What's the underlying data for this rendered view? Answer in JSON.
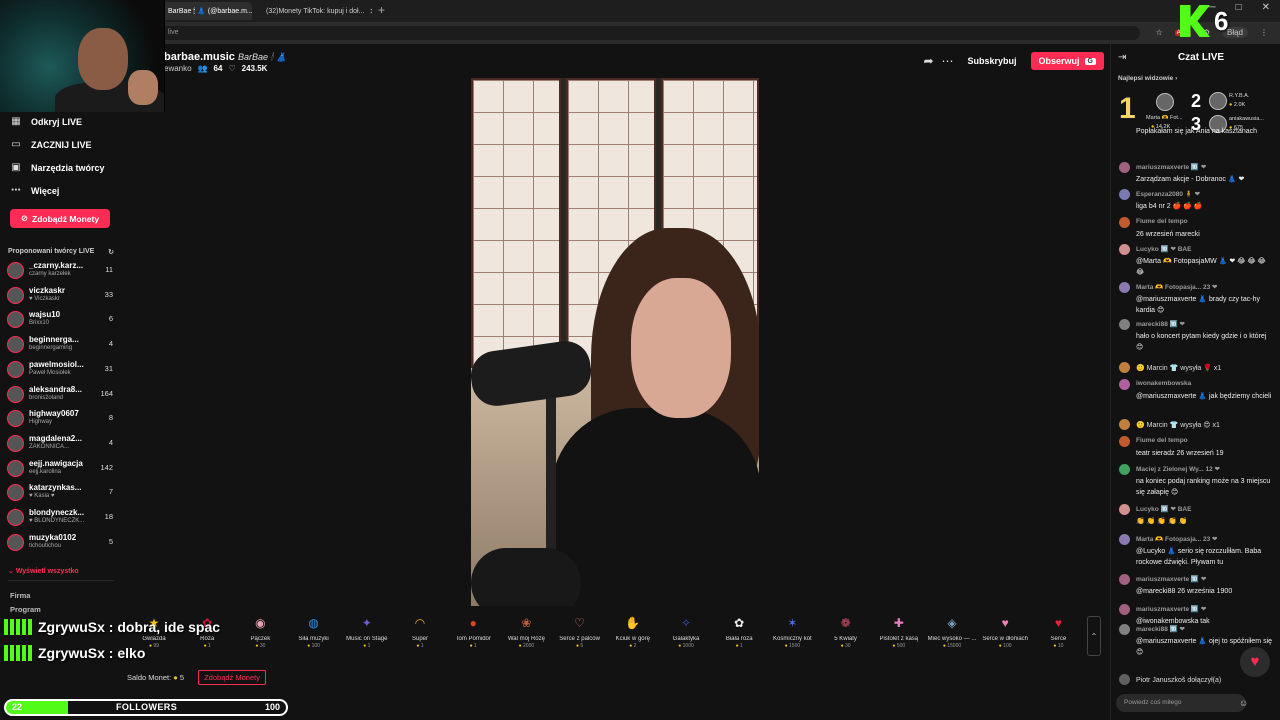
{
  "browser": {
    "tabs": [
      {
        "label": "BarBae 🕯 👗 (@barbae.m...",
        "active": true
      },
      {
        "label": "(32)Monety TikTok: kupuj i doł...",
        "active": false
      }
    ],
    "url": "live",
    "error_badge": "Błąd"
  },
  "stream": {
    "name": "barbae.music",
    "display_name": "BarBae 🕯 👗",
    "subtitle": "ewanko",
    "viewers": "64",
    "likes": "243.5K",
    "subscribe_label": "Subskrybuj",
    "follow_label": "Obserwuj",
    "follow_key": "G"
  },
  "sidebar": {
    "nav": [
      {
        "icon": "calendar-icon",
        "label": "Odkryj LIVE"
      },
      {
        "icon": "camera-icon",
        "label": "ZACZNIJ LIVE"
      },
      {
        "icon": "monitor-icon",
        "label": "Narzędzia twórcy"
      },
      {
        "icon": "more-icon",
        "label": "Więcej"
      }
    ],
    "coins_button": "Zdobądź Monety",
    "section_title": "Proponowani twórcy LIVE",
    "creators": [
      {
        "name": "_czarny.karz...",
        "sub": "czarny karzełek",
        "count": "11"
      },
      {
        "name": "viczkaskr",
        "sub": "♥ Viczkaskr",
        "count": "33"
      },
      {
        "name": "wajsu10",
        "sub": "Brixx10",
        "count": "6"
      },
      {
        "name": "beginnerga...",
        "sub": "beginnergaming",
        "count": "4"
      },
      {
        "name": "pawelmosiol...",
        "sub": "Paweł Mosiołek",
        "count": "31"
      },
      {
        "name": "aleksandra8...",
        "sub": "bronisżoland",
        "count": "164"
      },
      {
        "name": "highway0607",
        "sub": "Highway",
        "count": "8"
      },
      {
        "name": "magdalena2...",
        "sub": "ZAKONNICA...",
        "count": "4"
      },
      {
        "name": "eejj.nawigacja",
        "sub": "eejj.karolina",
        "count": "142"
      },
      {
        "name": "katarzynkas...",
        "sub": "♥ Kasia ♥",
        "count": "7"
      },
      {
        "name": "blondyneczk...",
        "sub": "♥ BLONDYNECZK...",
        "count": "18"
      },
      {
        "name": "muzyka0102",
        "sub": "tichoutichou",
        "count": "5"
      }
    ],
    "show_all": "Wyświetl wszystko",
    "footer": [
      "Firma",
      "Program"
    ]
  },
  "gifts": [
    {
      "name": "Gwiazda",
      "price": "99",
      "icon": "star-gift-icon",
      "color": "#f5c518",
      "glyph": "★"
    },
    {
      "name": "Róża",
      "price": "1",
      "icon": "rose-gift-icon",
      "color": "#c91a3a",
      "glyph": "✿"
    },
    {
      "name": "Pączek",
      "price": "30",
      "icon": "donut-gift-icon",
      "color": "#e8a0b0",
      "glyph": "◉"
    },
    {
      "name": "Siła muzyki",
      "price": "100",
      "icon": "globe-gift-icon",
      "color": "#3a8fd6",
      "glyph": "◍"
    },
    {
      "name": "Music on Stage",
      "price": "1",
      "icon": "stage-gift-icon",
      "color": "#6b5bd6",
      "glyph": "✦"
    },
    {
      "name": "Super",
      "price": "1",
      "icon": "glasses-gift-icon",
      "color": "#f5a623",
      "glyph": "◠"
    },
    {
      "name": "Tom Pomidor",
      "price": "1",
      "icon": "tomato-gift-icon",
      "color": "#d64520",
      "glyph": "●"
    },
    {
      "name": "Wal mój Różę",
      "price": "2000",
      "icon": "rose-bag-gift-icon",
      "color": "#c0603a",
      "glyph": "❀"
    },
    {
      "name": "Serce z palców",
      "price": "5",
      "icon": "finger-heart-gift-icon",
      "color": "#f0806a",
      "glyph": "♡"
    },
    {
      "name": "Kciuk w górę",
      "price": "2",
      "icon": "thumb-gift-icon",
      "color": "#f5b041",
      "glyph": "✋"
    },
    {
      "name": "Galaktyka",
      "price": "1000",
      "icon": "galaxy-gift-icon",
      "color": "#3d5ad6",
      "glyph": "✧"
    },
    {
      "name": "Biała róża",
      "price": "1",
      "icon": "white-rose-gift-icon",
      "color": "#eeeeee",
      "glyph": "✿"
    },
    {
      "name": "Kosmiczny kot",
      "price": "1500",
      "icon": "cat-gift-icon",
      "color": "#4a6ee0",
      "glyph": "✶"
    },
    {
      "name": "5 Kwiaty",
      "price": "30",
      "icon": "flowers-gift-icon",
      "color": "#d64a6a",
      "glyph": "❁"
    },
    {
      "name": "Pistolet z kasą",
      "price": "500",
      "icon": "money-gun-gift-icon",
      "color": "#e080c0",
      "glyph": "✚"
    },
    {
      "name": "Mieć wysoko — ...",
      "price": "15000",
      "icon": "jet-gift-icon",
      "color": "#7aa0c0",
      "glyph": "◈"
    },
    {
      "name": "Serce w dłoniach",
      "price": "100",
      "icon": "hands-heart-gift-icon",
      "color": "#f080b0",
      "glyph": "♥"
    },
    {
      "name": "Serce",
      "price": "10",
      "icon": "heart-gift-icon",
      "color": "#e6233a",
      "glyph": "♥"
    }
  ],
  "wallet": {
    "label": "Saldo Monet:",
    "amount": "5",
    "button": "Zdobądź Monety"
  },
  "overlay": {
    "chat_lines": [
      {
        "user": "ZgrywuSx",
        "text": "dobra, ide spac"
      },
      {
        "user": "ZgrywuSx",
        "text": "elko"
      }
    ],
    "kick_count": "6",
    "followers": {
      "current": 22,
      "goal": 100,
      "label": "FOLLOWERS"
    }
  },
  "chat": {
    "title": "Czat LIVE",
    "top_viewers_label": "Najlepsi widzowie",
    "top": [
      {
        "rank": "1",
        "name": "Marta 🫶 Fot...",
        "score": "14.2K"
      },
      {
        "rank": "2",
        "name": "R.Y.B.A.",
        "score": "2.0K"
      },
      {
        "rank": "3",
        "name": "aniakawusia...",
        "score": "675"
      }
    ],
    "messages": [
      {
        "user": "",
        "text": "Popłakałam się jak Ania na kasztanach",
        "color": "#8a5a3a"
      },
      {
        "user": "mariuszmaxverte 🔟 ❤",
        "text": "Zarządzam akcje - Dobranoc 👗 ❤",
        "color": "#a06080"
      },
      {
        "user": "Esperanza2080 🧍 ❤",
        "text": "liga b4 nr 2 🍎 🍎 🍎",
        "color": "#7a7ab0"
      },
      {
        "user": "Fiume del tempo",
        "text": "26 wrzesień marecki",
        "color": "#c05a30"
      },
      {
        "user": "Lucyko 🔟 ❤ BAE",
        "text": "@Marta 🫶 FotopasjaMW 👗 ❤ 😂 😂 😂 😂",
        "color": "#d09090"
      },
      {
        "user": "Marta 🫶 Fotopasja... 23 ❤",
        "text": "@mariuszmaxverte 👗 brady czy tac-hy kardia 😊",
        "color": "#8a7ab0"
      },
      {
        "user": "marecki88 🔟 ❤",
        "text": "hało o koncert pytam kiedy gdzie i o której 😊",
        "color": "#808080"
      },
      {
        "user": "",
        "text": "🙂 Marcin 👕 wysyła 🌹 x1",
        "color": "#c08040",
        "system": true
      },
      {
        "user": "iwonakembowska",
        "text": "@mariuszmaxverte 👗 jak będziemy chcieli",
        "color": "#b060a0"
      },
      {
        "user": "",
        "text": "🙂 Marcin 👕 wysyła 😍 x1",
        "color": "#c08040",
        "system": true
      },
      {
        "user": "Fiume del tempo",
        "text": "teatr sieradz 26 wrzesień 19",
        "color": "#c05a30"
      },
      {
        "user": "Maciej z Zielonej Wy... 12 ❤",
        "text": "na koniec podaj ranking może na 3 miejscu się załapię 😊",
        "color": "#40a060"
      },
      {
        "user": "Lucyko 🔟 ❤ BAE",
        "text": "👏 👏 👏 👏 👏",
        "color": "#d09090"
      },
      {
        "user": "Marta 🫶 Fotopasja... 23 ❤",
        "text": "@Lucyko 👗 serio się rozczuliłam. Baba rockowe dźwięki. Pływam tu",
        "color": "#8a7ab0"
      },
      {
        "user": "mariuszmaxverte 🔟 ❤",
        "text": "@marecki88 26 września 1900",
        "color": "#a06080"
      },
      {
        "user": "mariuszmaxverte 🔟 ❤",
        "text": "@iwonakembowska tak",
        "color": "#a06080"
      },
      {
        "user": "marecki88 🔟 ❤",
        "text": "@mariuszmaxverte 👗 ojej to spóźniłem się 😊",
        "color": "#808080"
      },
      {
        "user": "",
        "text": "Piotr Januszkoš dołączył(a)",
        "color": "#606060",
        "system": true
      }
    ],
    "input_placeholder": "Powiedz coś miłego"
  }
}
